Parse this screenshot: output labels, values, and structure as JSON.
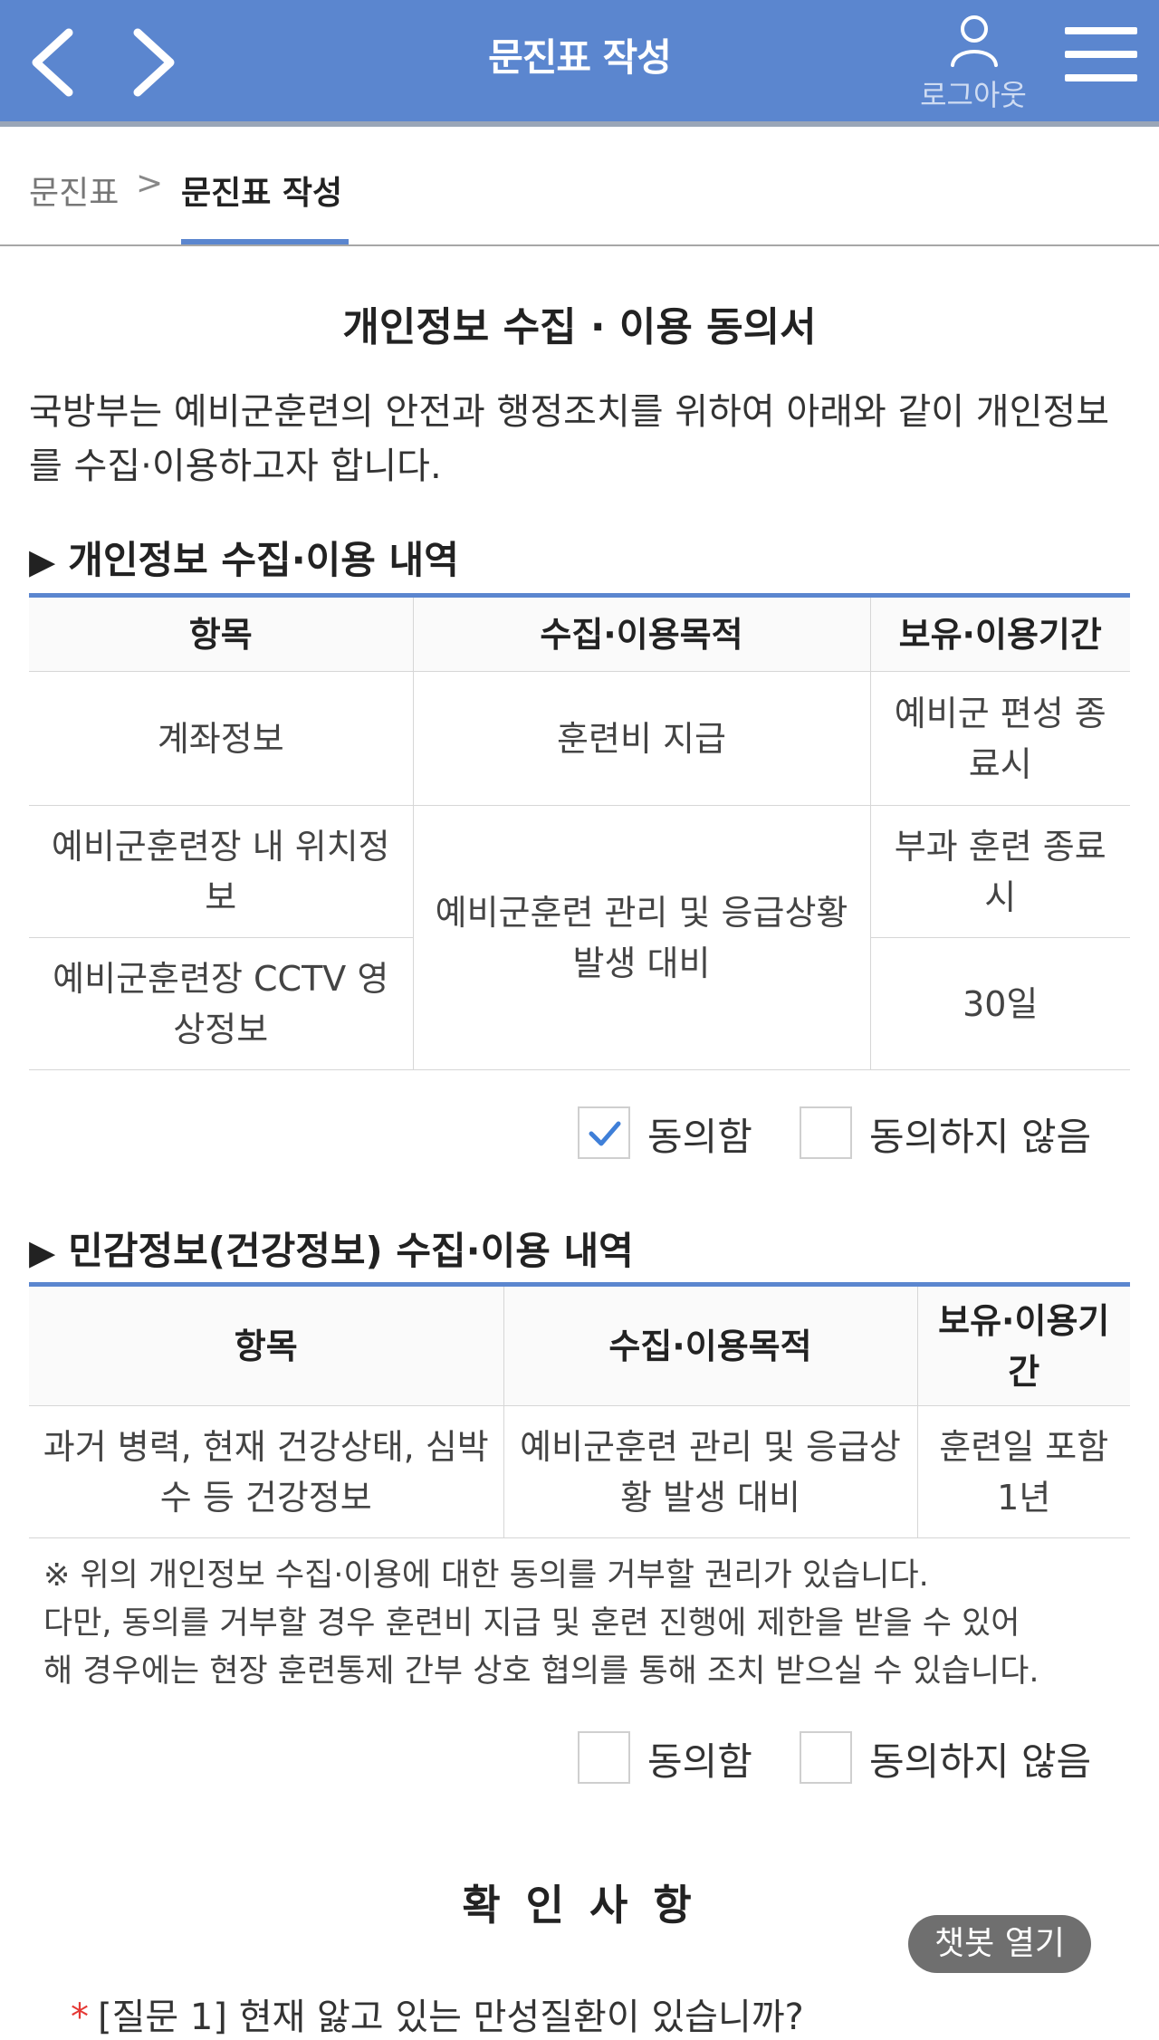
{
  "header": {
    "title": "문진표 작성",
    "logout_label": "로그아웃",
    "color": "#5b86cf",
    "icons": {
      "back": "chevron-left-icon",
      "forward": "chevron-right-icon",
      "user": "user-icon",
      "menu": "hamburger-menu-icon"
    }
  },
  "breadcrumb": {
    "parent": "문진표",
    "separator": ">",
    "current": "문진표 작성"
  },
  "document": {
    "title": "개인정보 수집 · 이용 동의서",
    "intro": "국방부는 예비군훈련의 안전과 행정조치를 위하여 아래와 같이 개인정보를 수집·이용하고자 합니다."
  },
  "section1": {
    "heading": "개인정보 수집·이용 내역",
    "headers": [
      "항목",
      "수집·이용목적",
      "보유·이용기간"
    ],
    "rows": [
      {
        "item": "계좌정보",
        "purpose": "훈련비 지급",
        "period": "예비군 편성 종료시"
      },
      {
        "item": "예비군훈련장 내 위치정보",
        "purpose": "예비군훈련 관리 및 응급상황 발생 대비",
        "period": "부과 훈련 종료시"
      },
      {
        "item": "예비군훈련장 CCTV 영상정보",
        "period": "30일"
      }
    ],
    "agree_label": "동의함",
    "disagree_label": "동의하지 않음",
    "agree_checked": true,
    "disagree_checked": false
  },
  "section2": {
    "heading": "민감정보(건강정보) 수집·이용 내역",
    "headers": [
      "항목",
      "수집·이용목적",
      "보유·이용기간"
    ],
    "rows": [
      {
        "item": "과거 병력, 현재 건강상태, 심박수 등 건강정보",
        "purpose": "예비군훈련 관리 및 응급상황 발생 대비",
        "period": "훈련일 포함 1년"
      }
    ],
    "notice": [
      "※ 위의 개인정보 수집·이용에 대한 동의를 거부할 권리가 있습니다.",
      "다만, 동의를 거부할 경우 훈련비 지급 및 훈련 진행에 제한을 받을 수 있어",
      "해 경우에는 현장 훈련통제 간부 상호 협의를 통해 조치 받으실 수 있습니다."
    ],
    "agree_label": "동의함",
    "disagree_label": "동의하지 않음",
    "agree_checked": false,
    "disagree_checked": false
  },
  "confirm": {
    "title": "확 인 사 항",
    "chatbot_label": "챗봇 열기",
    "question1": "[질문 1] 현재 앓고 있는 만성질환이 있습니까?",
    "required_mark": "*"
  }
}
